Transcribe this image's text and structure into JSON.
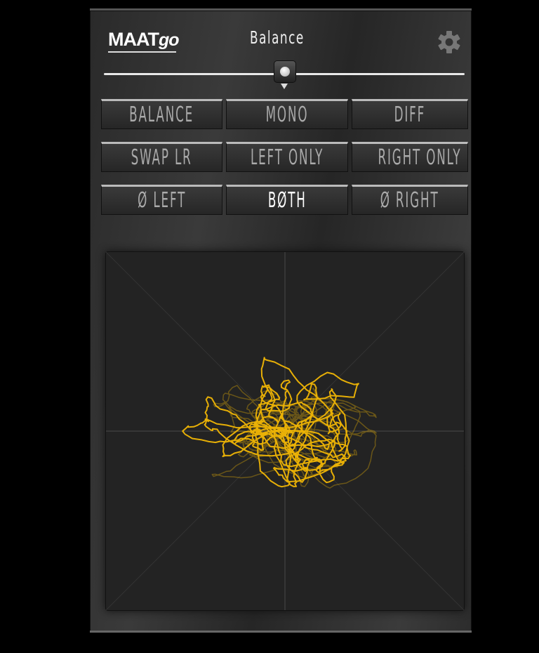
{
  "header": {
    "logo": {
      "main": "MAAT",
      "sub": "go"
    },
    "title": "Balance",
    "settings_icon": "gear-icon"
  },
  "balance_slider": {
    "value_percent": 50
  },
  "buttons": [
    {
      "label": "BALANCE",
      "active": false
    },
    {
      "label": "MONO",
      "active": false
    },
    {
      "label": "DIFF",
      "active": false
    },
    {
      "label": "SWAP LR",
      "active": false
    },
    {
      "label": "LEFT ONLY",
      "active": false
    },
    {
      "label": "RIGHT ONLY",
      "active": false
    },
    {
      "label": "Ø LEFT",
      "active": false
    },
    {
      "label": "BØTH",
      "active": true
    },
    {
      "label": "Ø RIGHT",
      "active": false
    }
  ],
  "scope": {
    "trace_color": "#f2b705",
    "grid_color": "#4a4a4a"
  }
}
